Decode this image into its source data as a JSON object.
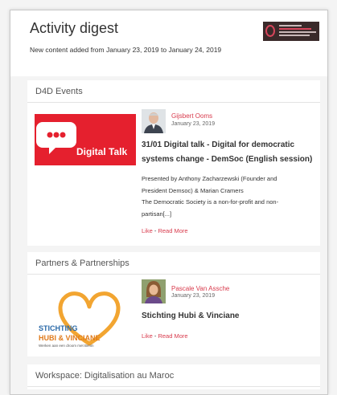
{
  "header": {
    "title": "Activity digest",
    "subtitle": "New content added from January 23, 2019 to January 24, 2019"
  },
  "sections": [
    {
      "heading": "D4D Events",
      "post": {
        "thumbnail_text": "Digital Talk",
        "author": "Gijsbert Ooms",
        "date": "January 23, 2019",
        "title_line1": "31/01 Digital talk - Digital for democratic",
        "title_line2": "systems change - DemSoc (English session)",
        "desc_lines": [
          "Presented by Anthony Zacharzewski (Founder and",
          "President Demsoc) & Marian Cramers",
          "The Democratic Society is a non-for-profit and non-",
          "partisan[...]"
        ],
        "like": "Like",
        "sep": "-",
        "read_more": "Read More"
      }
    },
    {
      "heading": "Partners & Partnerships",
      "post": {
        "logo_line1": "STICHTING",
        "logo_line2": "HUBI & VINCIANE",
        "logo_tagline": "Werken aan een droom met Benin",
        "author": "Pascale Van Assche",
        "date": "January 23, 2019",
        "title": "Stichting Hubi & Vinciane",
        "like": "Like",
        "sep": "-",
        "read_more": "Read More"
      }
    },
    {
      "heading": "Workspace: Digitalisation au Maroc"
    }
  ],
  "colors": {
    "accent": "#d83a4c",
    "digital_talk_red": "#e5202e",
    "heart_orange": "#f2a531",
    "stichting_blue": "#2b6aa8"
  }
}
